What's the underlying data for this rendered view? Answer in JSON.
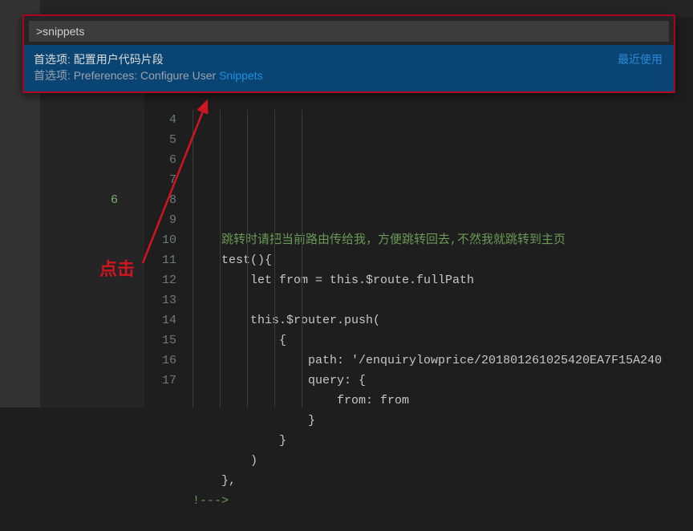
{
  "palette": {
    "input_value": ">snippets",
    "item": {
      "title": "首选项: 配置用户代码片段",
      "subtitle_prefix": "首选项: Preferences: Configure User ",
      "subtitle_highlight": "Snippets",
      "badge": "最近使用"
    }
  },
  "gutter": {
    "annotation": "6",
    "lines": [
      "4",
      "5",
      "6",
      "7",
      "8",
      "9",
      "10",
      "11",
      "12",
      "13",
      "14",
      "15",
      "16",
      "17"
    ]
  },
  "code": {
    "l4": "    跳转时请把当前路由传给我，方便跳转回去,不然我就跳转到主页",
    "l5": "    test(){",
    "l6": "        let from = this.$route.fullPath",
    "l7": "        ",
    "l8": "        this.$router.push(",
    "l9": "            {",
    "l10": "                path: '/enquirylowprice/201801261025420EA7F15A240",
    "l11": "                query: {",
    "l12": "                    from: from",
    "l13": "                }",
    "l14": "            }",
    "l15": "        )",
    "l16": "    },",
    "l17": "!--->"
  },
  "annotation": {
    "label": "点击"
  }
}
